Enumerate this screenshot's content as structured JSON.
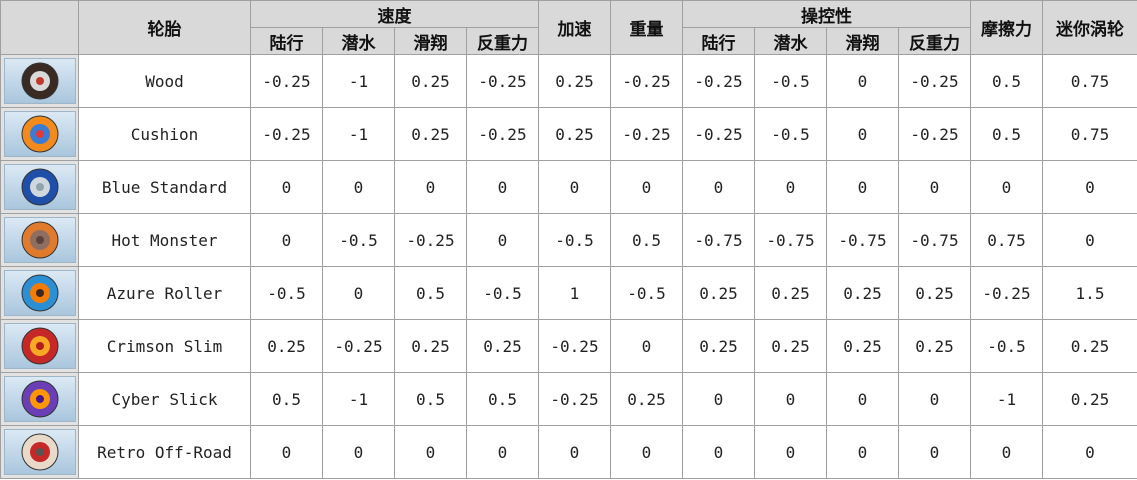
{
  "headers": {
    "tire": "轮胎",
    "speed": "速度",
    "acceleration": "加速",
    "weight": "重量",
    "handling": "操控性",
    "traction": "摩擦力",
    "mini_turbo": "迷你涡轮",
    "terrain": [
      "陆行",
      "潜水",
      "滑翔",
      "反重力"
    ]
  },
  "tires": [
    {
      "name": "Wood",
      "icon": "wood-tire-icon",
      "colors": {
        "tread": "#3a2a24",
        "rim": "#d9d9d9",
        "hub": "#c0392b"
      },
      "values": [
        "-0.25",
        "-1",
        "0.25",
        "-0.25",
        "0.25",
        "-0.25",
        "-0.25",
        "-0.5",
        "0",
        "-0.25",
        "0.5",
        "0.75"
      ]
    },
    {
      "name": "Cushion",
      "icon": "cushion-tire-icon",
      "colors": {
        "tread": "#f28a1c",
        "rim": "#3a7bd5",
        "hub": "#e53935"
      },
      "values": [
        "-0.25",
        "-1",
        "0.25",
        "-0.25",
        "0.25",
        "-0.25",
        "-0.25",
        "-0.5",
        "0",
        "-0.25",
        "0.5",
        "0.75"
      ]
    },
    {
      "name": "Blue Standard",
      "icon": "blue-standard-tire-icon",
      "colors": {
        "tread": "#1f4fa8",
        "rim": "#cfd8dc",
        "hub": "#90a4ae"
      },
      "values": [
        "0",
        "0",
        "0",
        "0",
        "0",
        "0",
        "0",
        "0",
        "0",
        "0",
        "0",
        "0"
      ]
    },
    {
      "name": "Hot Monster",
      "icon": "hot-monster-tire-icon",
      "colors": {
        "tread": "#e07b2e",
        "rim": "#8d6e63",
        "hub": "#5d4037"
      },
      "values": [
        "0",
        "-0.5",
        "-0.25",
        "0",
        "-0.5",
        "0.5",
        "-0.75",
        "-0.75",
        "-0.75",
        "-0.75",
        "0.75",
        "0"
      ]
    },
    {
      "name": "Azure Roller",
      "icon": "azure-roller-tire-icon",
      "colors": {
        "tread": "#2b8fd6",
        "rim": "#f57c00",
        "hub": "#3e2723"
      },
      "values": [
        "-0.5",
        "0",
        "0.5",
        "-0.5",
        "1",
        "-0.5",
        "0.25",
        "0.25",
        "0.25",
        "0.25",
        "-0.25",
        "1.5"
      ]
    },
    {
      "name": "Crimson Slim",
      "icon": "crimson-slim-tire-icon",
      "colors": {
        "tread": "#c62828",
        "rim": "#f9a825",
        "hub": "#b71c1c"
      },
      "values": [
        "0.25",
        "-0.25",
        "0.25",
        "0.25",
        "-0.25",
        "0",
        "0.25",
        "0.25",
        "0.25",
        "0.25",
        "-0.5",
        "0.25"
      ]
    },
    {
      "name": "Cyber Slick",
      "icon": "cyber-slick-tire-icon",
      "colors": {
        "tread": "#6a3fb5",
        "rim": "#ff9800",
        "hub": "#4a148c"
      },
      "values": [
        "0.5",
        "-1",
        "0.5",
        "0.5",
        "-0.25",
        "0.25",
        "0",
        "0",
        "0",
        "0",
        "-1",
        "0.25"
      ]
    },
    {
      "name": "Retro Off-Road",
      "icon": "retro-off-road-tire-icon",
      "colors": {
        "tread": "#e8d9c8",
        "rim": "#c62828",
        "hub": "#555555"
      },
      "values": [
        "0",
        "0",
        "0",
        "0",
        "0",
        "0",
        "0",
        "0",
        "0",
        "0",
        "0",
        "0"
      ]
    }
  ]
}
